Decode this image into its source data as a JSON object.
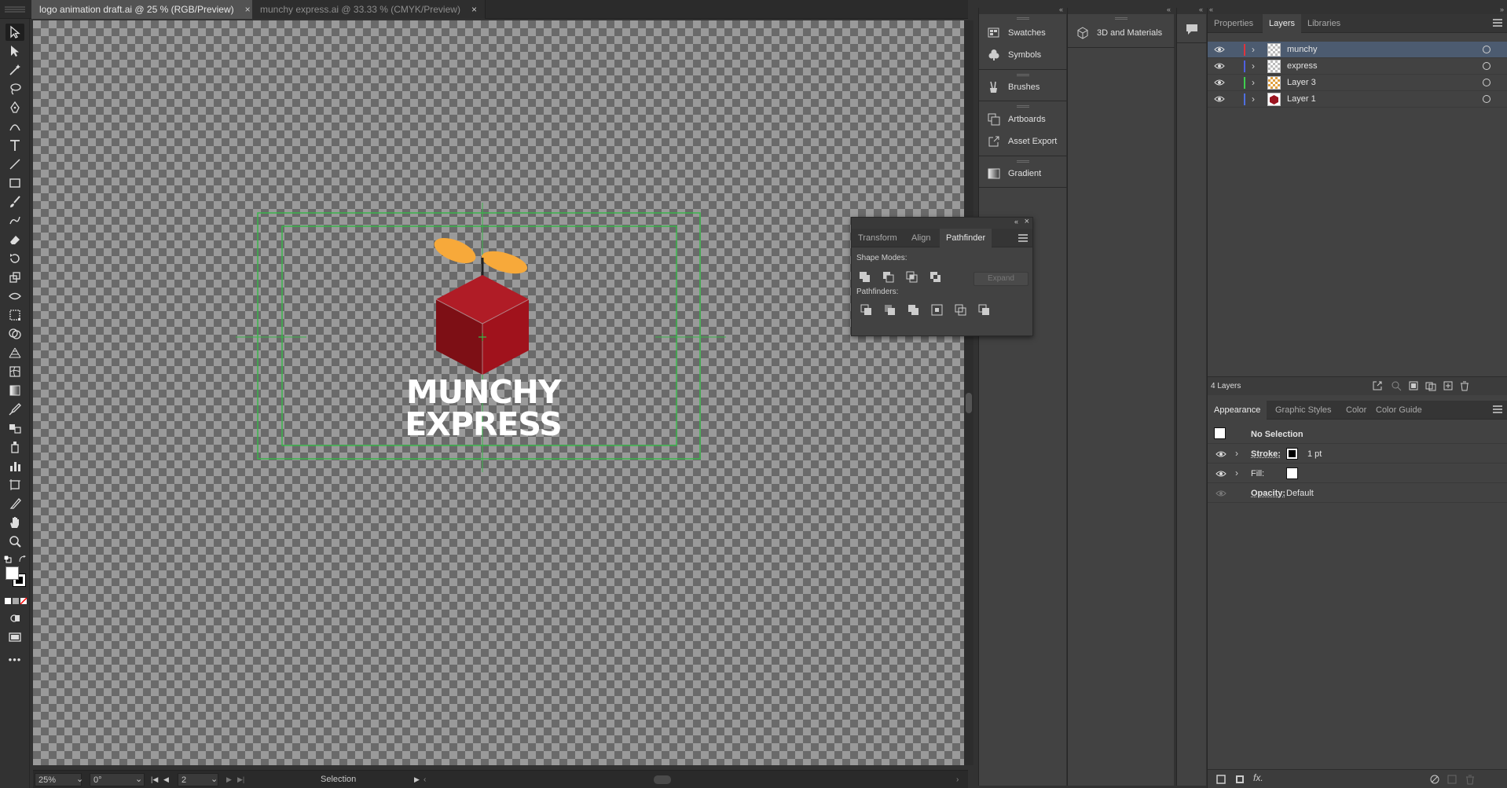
{
  "document_tabs": [
    {
      "title": "logo animation draft.ai @ 25 % (RGB/Preview)",
      "close": "×",
      "active": true
    },
    {
      "title": "munchy express.ai @ 33.33 % (CMYK/Preview)",
      "close": "×",
      "active": false
    }
  ],
  "toolbar": {
    "tools": [
      "selection-tool",
      "direct-selection-tool",
      "magic-wand-tool",
      "lasso-tool",
      "pen-tool",
      "curvature-tool",
      "type-tool",
      "line-segment-tool",
      "rectangle-tool",
      "paintbrush-tool",
      "shaper-tool",
      "eraser-tool",
      "rotate-tool",
      "scale-tool",
      "width-tool",
      "free-transform-tool",
      "shape-builder-tool",
      "perspective-grid-tool",
      "mesh-tool",
      "gradient-tool",
      "eyedropper-tool",
      "blend-tool",
      "symbol-sprayer-tool",
      "column-graph-tool",
      "artboard-tool",
      "slice-tool",
      "hand-tool",
      "zoom-tool"
    ],
    "more_label": "•••"
  },
  "artwork": {
    "line1": "MUNCHY",
    "line2": "EXPRESS",
    "colors": {
      "cube_light": "#b01c26",
      "cube_dark": "#7d0f15",
      "propeller": "#f7a93a",
      "guides": "#39b54a"
    }
  },
  "statusbar": {
    "zoom": "25%",
    "rotation": "0°",
    "artboard": "2",
    "tool": "Selection"
  },
  "dock1": {
    "items": [
      {
        "icon": "swatches-icon",
        "label": "Swatches"
      },
      {
        "icon": "symbols-icon",
        "label": "Symbols"
      },
      {
        "icon": "brushes-icon",
        "label": "Brushes"
      },
      {
        "icon": "artboards-icon",
        "label": "Artboards"
      },
      {
        "icon": "asset-export-icon",
        "label": "Asset Export"
      },
      {
        "icon": "gradient-icon",
        "label": "Gradient"
      }
    ]
  },
  "dock2": {
    "items": [
      {
        "icon": "3d-materials-icon",
        "label": "3D and Materials"
      }
    ]
  },
  "pathfinder_panel": {
    "tabs": [
      "Transform",
      "Align",
      "Pathfinder"
    ],
    "active_tab": "Pathfinder",
    "shape_modes_label": "Shape Modes:",
    "pathfinders_label": "Pathfinders:",
    "expand_label": "Expand"
  },
  "layers_panel": {
    "tabs": [
      "Properties",
      "Layers",
      "Libraries"
    ],
    "active_tab": "Layers",
    "layers": [
      {
        "name": "munchy",
        "color": "#e0343c",
        "selected": true
      },
      {
        "name": "express",
        "color": "#4f5fe0",
        "selected": false
      },
      {
        "name": "Layer 3",
        "color": "#3fcf4f",
        "selected": false
      },
      {
        "name": "Layer 1",
        "color": "#4f6fe0",
        "selected": false
      }
    ],
    "count_label": "4 Layers"
  },
  "appearance_panel": {
    "tabs": [
      "Appearance",
      "Graphic Styles",
      "Color",
      "Color Guide"
    ],
    "active_tab": "Appearance",
    "title": "No Selection",
    "stroke_label": "Stroke:",
    "stroke_value": "1 pt",
    "fill_label": "Fill:",
    "opacity_label": "Opacity:",
    "opacity_value": "Default",
    "fx_label": "fx."
  }
}
